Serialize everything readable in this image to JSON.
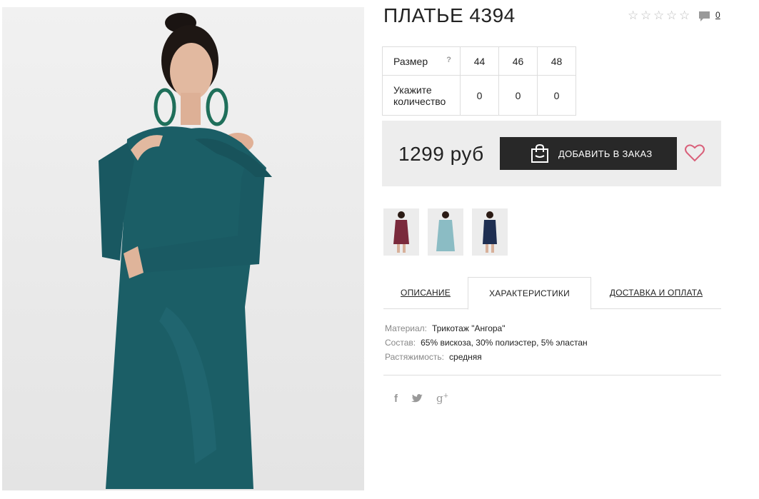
{
  "product": {
    "title": "ПЛАТЬЕ 4394",
    "rating_stars": 0,
    "rating_max": 5,
    "comments_count": "0"
  },
  "size_table": {
    "size_label": "Размер",
    "help": "?",
    "sizes": [
      "44",
      "46",
      "48"
    ],
    "qty_label_line1": "Укажите",
    "qty_label_line2": "количество",
    "quantities": [
      "0",
      "0",
      "0"
    ]
  },
  "purchase": {
    "price": "1299 руб",
    "add_button_label": "ДОБАВИТЬ В ЗАКАЗ"
  },
  "thumbnails": [
    {
      "color": "#7a2a3c",
      "icon": "dress-thumbnail-burgundy"
    },
    {
      "color": "#8bbcc4",
      "icon": "dress-thumbnail-light-blue"
    },
    {
      "color": "#1f2f52",
      "icon": "dress-thumbnail-navy"
    }
  ],
  "tabs": [
    {
      "label": "ОПИСАНИЕ",
      "active": false
    },
    {
      "label": "ХАРАКТЕРИСТИКИ",
      "active": true
    },
    {
      "label": "ДОСТАВКА И ОПЛАТА",
      "active": false
    }
  ],
  "specs": [
    {
      "key": "Материал:",
      "value": "Трикотаж \"Ангора\""
    },
    {
      "key": "Состав:",
      "value": "65% вискоза, 30% полиэстер, 5% эластан"
    },
    {
      "key": "Растяжимость:",
      "value": "средняя"
    }
  ],
  "social": [
    {
      "name": "facebook-icon",
      "glyph": "f"
    },
    {
      "name": "twitter-icon",
      "glyph": "twitter"
    },
    {
      "name": "google-plus-icon",
      "glyph": "g+"
    }
  ],
  "colors": {
    "dress": "#1b5e66",
    "button_bg": "#282828",
    "price_box_bg": "#ededed",
    "heart": "#d9607a"
  }
}
